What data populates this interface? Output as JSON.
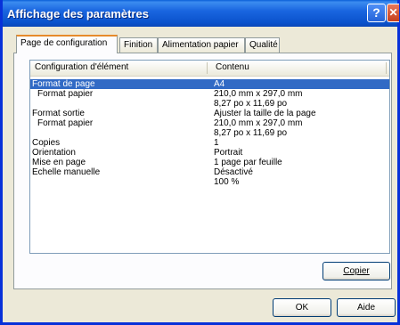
{
  "window": {
    "title": "Affichage des paramètres"
  },
  "titlebar_buttons": {
    "help": "?",
    "close": "✕"
  },
  "tabs": [
    {
      "label": "Page de configuration"
    },
    {
      "label": "Finition"
    },
    {
      "label": "Alimentation papier"
    },
    {
      "label": "Qualité"
    }
  ],
  "table": {
    "columns": [
      "Configuration d'élément",
      "Contenu"
    ],
    "rows": [
      {
        "item": "Format de page",
        "value": "A4"
      },
      {
        "item": "Format papier",
        "value": "210,0 mm x  297,0 mm"
      },
      {
        "item": "",
        "value": "8,27 po x 11,69 po"
      },
      {
        "item": "Format sortie",
        "value": "Ajuster la taille de la page"
      },
      {
        "item": "Format papier",
        "value": "210,0 mm x  297,0 mm"
      },
      {
        "item": "",
        "value": "8,27 po x 11,69 po"
      },
      {
        "item": "Copies",
        "value": "1"
      },
      {
        "item": "Orientation",
        "value": "Portrait"
      },
      {
        "item": "Mise en page",
        "value": "1 page par feuille"
      },
      {
        "item": "Echelle manuelle",
        "value": "Désactivé"
      },
      {
        "item": "",
        "value": "100 %"
      }
    ]
  },
  "buttons": {
    "copy": "Copier",
    "ok": "OK",
    "help": "Aide"
  },
  "colors": {
    "titlebar": "#0a52cc",
    "selection": "#316ac5",
    "tab_highlight": "#e68b2c"
  }
}
